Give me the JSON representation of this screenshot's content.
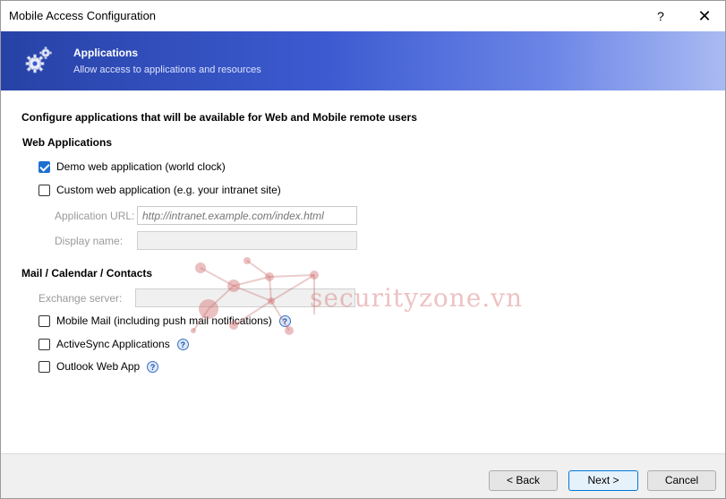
{
  "window": {
    "title": "Mobile Access Configuration",
    "help_label": "?",
    "close_label": "✕"
  },
  "banner": {
    "icon": "gears-icon",
    "title": "Applications",
    "subtitle": "Allow access to applications and resources"
  },
  "main": {
    "heading": "Configure applications that will be available for Web and Mobile remote users",
    "web_apps": {
      "section_label": "Web Applications",
      "demo_app": {
        "label": "Demo web application (world clock)",
        "checked": true
      },
      "custom_app": {
        "label": "Custom web application (e.g. your intranet site)",
        "checked": false
      },
      "app_url": {
        "label": "Application URL:",
        "placeholder": "http://intranet.example.com/index.html",
        "value": ""
      },
      "display_name": {
        "label": "Display name:",
        "value": ""
      }
    },
    "mail": {
      "section_label": "Mail / Calendar / Contacts",
      "exchange_server": {
        "label": "Exchange server:",
        "value": ""
      },
      "mobile_mail": {
        "label": "Mobile Mail (including push mail notifications)",
        "checked": false
      },
      "activesync": {
        "label": "ActiveSync Applications",
        "checked": false
      },
      "owa": {
        "label": "Outlook Web App",
        "checked": false
      }
    }
  },
  "footer": {
    "back_label": "< Back",
    "next_label": "Next >",
    "cancel_label": "Cancel"
  },
  "watermark": {
    "text": "securityzone.vn"
  },
  "colors": {
    "banner": "#3d5bd1",
    "accent": "#1f6fd1"
  }
}
